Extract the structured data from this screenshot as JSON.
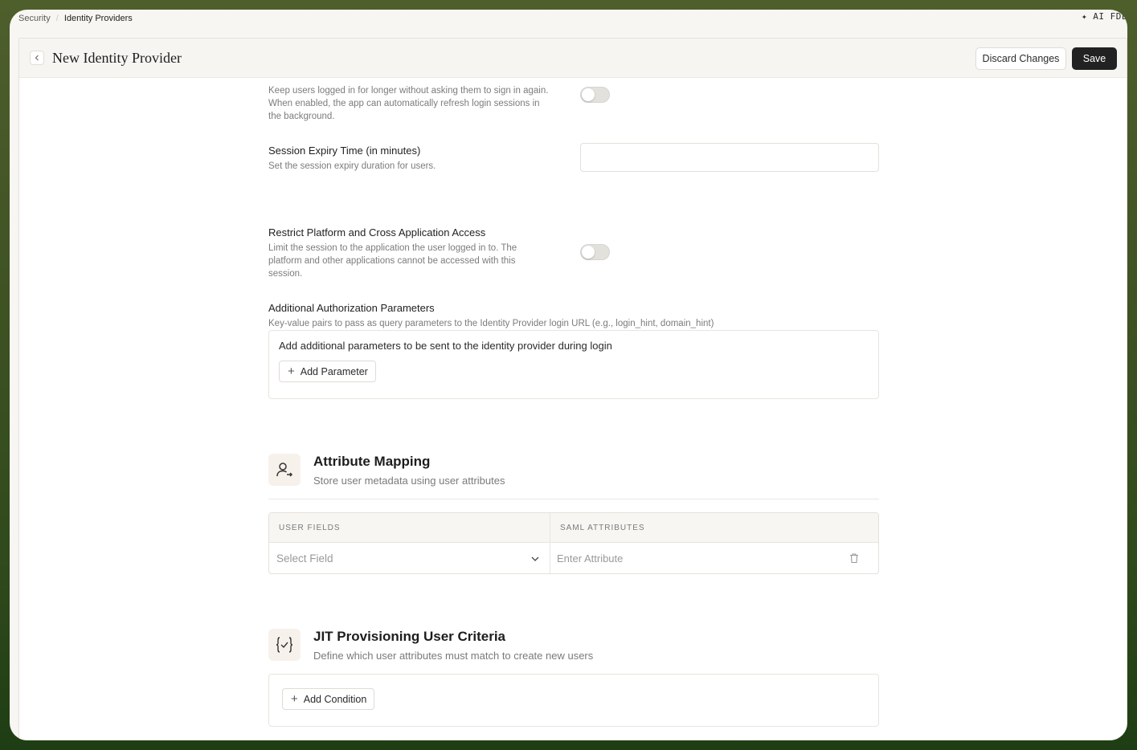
{
  "breadcrumb": {
    "parent": "Security",
    "current": "Identity Providers"
  },
  "topbar": {
    "ai_label": "✦ AI FDE"
  },
  "header": {
    "title": "New Identity Provider",
    "discard_label": "Discard Changes",
    "save_label": "Save"
  },
  "session_refresh": {
    "description": "Keep users logged in for longer without asking them to sign in again. When enabled, the app can automatically refresh login sessions in the background.",
    "enabled": false
  },
  "session_expiry": {
    "title": "Session Expiry Time (in minutes)",
    "description": "Set the session expiry duration for users.",
    "value": ""
  },
  "restrict_access": {
    "title": "Restrict Platform and Cross Application Access",
    "description": "Limit the session to the application the user logged in to. The platform and other applications cannot be accessed with this session.",
    "enabled": false
  },
  "auth_params": {
    "title": "Additional Authorization Parameters",
    "description": "Key-value pairs to pass as query parameters to the Identity Provider login URL (e.g., login_hint, domain_hint)",
    "box_text": "Add additional parameters to be sent to the identity provider during login",
    "add_label": "Add Parameter"
  },
  "attribute_mapping": {
    "title": "Attribute Mapping",
    "subtitle": "Store user metadata using user attributes",
    "columns": [
      "USER FIELDS",
      "SAML ATTRIBUTES"
    ],
    "field_placeholder": "Select Field",
    "attribute_placeholder": "Enter Attribute"
  },
  "jit": {
    "title": "JIT Provisioning User Criteria",
    "subtitle": "Define which user attributes must match to create new users",
    "add_label": "Add Condition"
  }
}
